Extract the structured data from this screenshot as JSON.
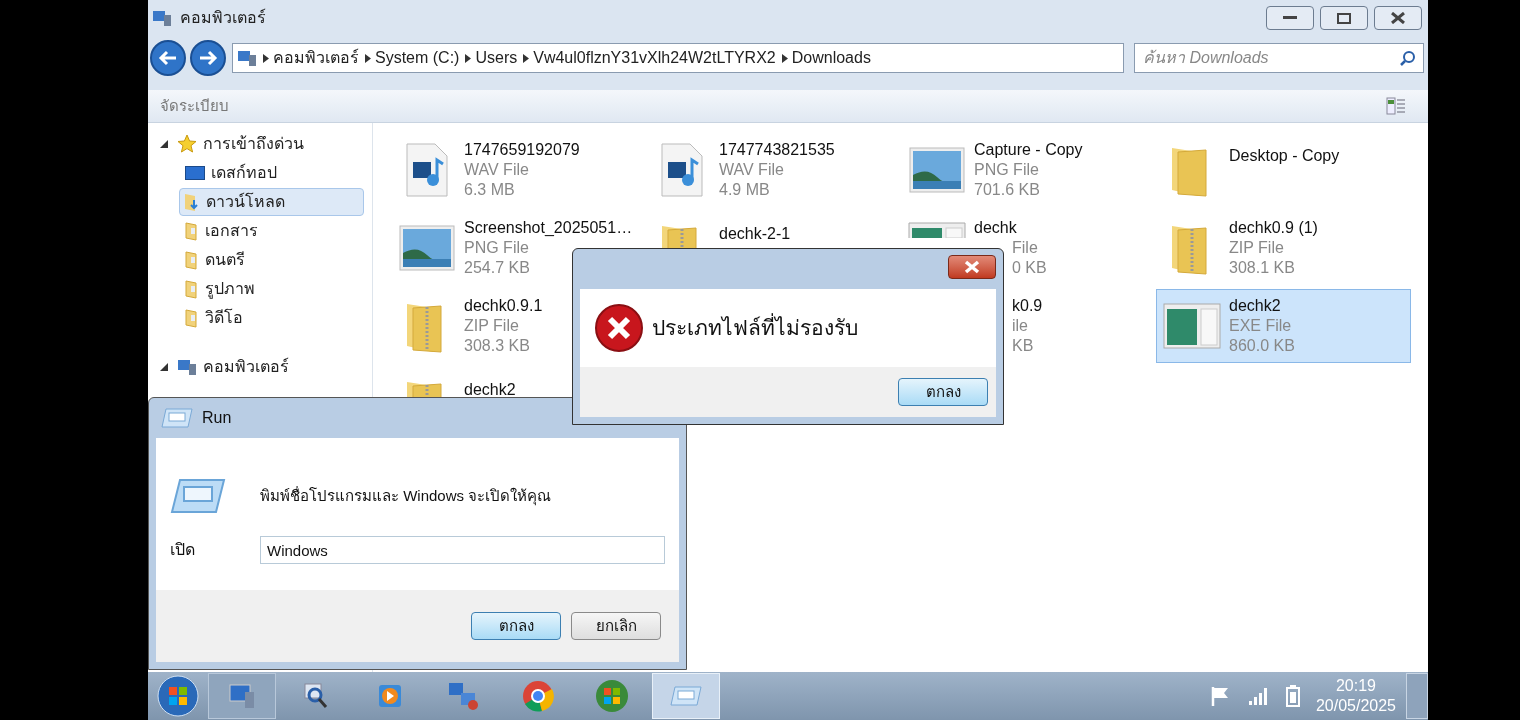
{
  "explorer": {
    "title": "คอมพิวเตอร์",
    "breadcrumb": [
      "คอมพิวเตอร์",
      "System (C:)",
      "Users",
      "Vw4ul0flznY31vXlh24W2tLTYRX2",
      "Downloads"
    ],
    "search": {
      "placeholder": "ค้นหา Downloads"
    },
    "toolbar": {
      "organize": "จัดระเบียบ"
    },
    "sidebar": [
      {
        "label": "การเข้าถึงด่วน",
        "kind": "star",
        "expanded": true,
        "selected": false,
        "children": [
          {
            "label": "เดสก์ทอป",
            "kind": "desktop",
            "selected": false
          },
          {
            "label": "ดาวน์โหลด",
            "kind": "download",
            "selected": true
          },
          {
            "label": "เอกสาร",
            "kind": "library",
            "selected": false
          },
          {
            "label": "ดนตรี",
            "kind": "library",
            "selected": false
          },
          {
            "label": "รูปภาพ",
            "kind": "library",
            "selected": false
          },
          {
            "label": "วิดีโอ",
            "kind": "library",
            "selected": false
          }
        ]
      },
      {
        "label": "คอมพิวเตอร์",
        "kind": "computer",
        "expanded": true,
        "selected": false
      }
    ],
    "files": [
      {
        "name": "1747659192079",
        "type": "WAV File",
        "size": "6.3 MB",
        "kind": "wav",
        "selected": false
      },
      {
        "name": "1747743821535",
        "type": "WAV File",
        "size": "4.9 MB",
        "kind": "wav",
        "selected": false
      },
      {
        "name": "Capture - Copy",
        "type": "PNG File",
        "size": "701.6 KB",
        "kind": "png",
        "selected": false
      },
      {
        "name": "Desktop - Copy",
        "kind": "folder",
        "selected": false
      },
      {
        "name": "Screenshot_2025051…",
        "type": "PNG File",
        "size": "254.7 KB",
        "kind": "png",
        "selected": false
      },
      {
        "name": "dechk-2-1",
        "kind": "zip",
        "selected": false
      },
      {
        "name": "dechk",
        "type": "File",
        "size": "0 KB",
        "kind": "exe",
        "details_covered": true,
        "selected": false
      },
      {
        "name": "dechk0.9 (1)",
        "type": "ZIP File",
        "size": "308.1 KB",
        "kind": "zip",
        "selected": false
      },
      {
        "name": "dechk0.9.1",
        "type": "ZIP File",
        "size": "308.3 KB",
        "kind": "zip",
        "selected": false
      },
      {
        "kind": "hidden"
      },
      {
        "name": "k0.9",
        "type": "ile",
        "size": "KB",
        "kind": "zip",
        "details_covered": true,
        "name_covered": true,
        "selected": false
      },
      {
        "name": "dechk2",
        "type": "EXE File",
        "size": "860.0 KB",
        "kind": "exe",
        "selected": true
      },
      {
        "name": "dechk2",
        "kind": "zip",
        "selected": false
      }
    ]
  },
  "error_dialog": {
    "message": "ประเภทไฟล์ที่ไม่รองรับ",
    "ok": "ตกลง"
  },
  "run_dialog": {
    "title": "Run",
    "prompt": "พิมพ์ชื่อโปรแกรมและ Windows จะเปิดให้คุณ",
    "open_label": "เปิด",
    "value": "Windows",
    "ok": "ตกลง",
    "cancel": "ยกเลิก"
  },
  "taskbar": {
    "apps": [
      {
        "kind": "explorer",
        "active": false
      },
      {
        "kind": "search",
        "active": false
      },
      {
        "kind": "media",
        "active": false
      },
      {
        "kind": "network",
        "active": false
      },
      {
        "kind": "chrome",
        "active": false
      },
      {
        "kind": "windows",
        "active": false
      },
      {
        "kind": "run",
        "active": true
      }
    ],
    "time": "20:19",
    "date": "20/05/2025"
  }
}
